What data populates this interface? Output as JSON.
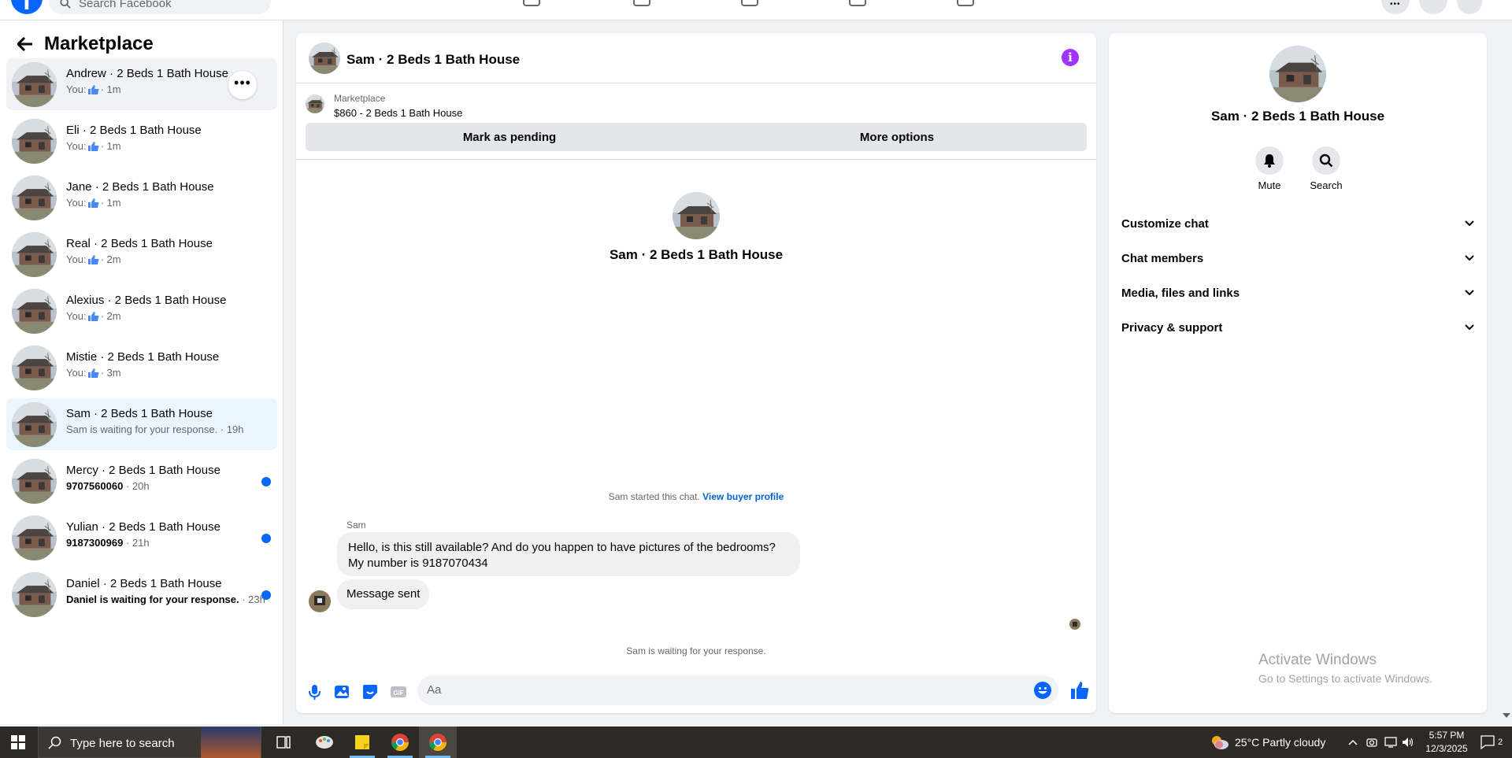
{
  "topbar": {
    "search_placeholder": "Search Facebook"
  },
  "sidebar": {
    "title": "Marketplace",
    "conversations": [
      {
        "name": "Andrew · 2 Beds 1 Bath House",
        "prefix": "You:",
        "time": "· 1m",
        "liked": true,
        "unread": false
      },
      {
        "name": "Eli · 2 Beds 1 Bath House",
        "prefix": "You:",
        "time": "· 1m",
        "liked": true,
        "unread": false
      },
      {
        "name": "Jane · 2 Beds 1 Bath House",
        "prefix": "You:",
        "time": "· 1m",
        "liked": true,
        "unread": false
      },
      {
        "name": "Real · 2 Beds 1 Bath House",
        "prefix": "You:",
        "time": "· 2m",
        "liked": true,
        "unread": false
      },
      {
        "name": "Alexius · 2 Beds 1 Bath House",
        "prefix": "You:",
        "time": "· 2m",
        "liked": true,
        "unread": false
      },
      {
        "name": "Mistie · 2 Beds 1 Bath House",
        "prefix": "You:",
        "time": "· 3m",
        "liked": true,
        "unread": false
      },
      {
        "name": "Sam · 2 Beds 1 Bath House",
        "prefix": "Sam is waiting for your response.",
        "time": "· 19h",
        "liked": false,
        "unread": false
      },
      {
        "name": "Mercy · 2 Beds 1 Bath House",
        "prefix": "9707560060",
        "time": "· 20h",
        "liked": false,
        "unread": true
      },
      {
        "name": "Yulian · 2 Beds 1 Bath House",
        "prefix": "9187300969",
        "time": "· 21h",
        "liked": false,
        "unread": true
      },
      {
        "name": "Daniel · 2 Beds 1 Bath House",
        "prefix": "Daniel is waiting for your response.",
        "time": "· 23h",
        "liked": false,
        "unread": true
      }
    ]
  },
  "chat": {
    "title": "Sam · 2 Beds 1 Bath House",
    "marketplace_label": "Marketplace",
    "listing": "$860 - 2 Beds 1 Bath House",
    "mark_pending": "Mark as pending",
    "more_options": "More options",
    "center_title": "Sam · 2 Beds 1 Bath House",
    "started_text": "Sam started this chat.",
    "view_profile": "View buyer profile",
    "sender": "Sam",
    "message_line1": "Hello, is this still available? And do you happen to have pictures of the bedrooms?",
    "message_line2": "My number is 9187070434",
    "message2": "Message sent",
    "waiting": "Sam is waiting for your response.",
    "input_placeholder": "Aa"
  },
  "right_panel": {
    "name": "Sam · 2 Beds 1 Bath House",
    "mute": "Mute",
    "search": "Search",
    "rows": [
      "Customize chat",
      "Chat members",
      "Media, files and links",
      "Privacy & support"
    ],
    "activate_title": "Activate Windows",
    "activate_sub": "Go to Settings to activate Windows."
  },
  "taskbar": {
    "search_text": "Type here to search",
    "weather": "25°C  Partly cloudy",
    "time": "5:57 PM",
    "date": "12/3/2025",
    "notif_count": "2"
  },
  "colors": {
    "accent": "#0866ff",
    "link": "#0064d1",
    "info": "#a033ff"
  }
}
